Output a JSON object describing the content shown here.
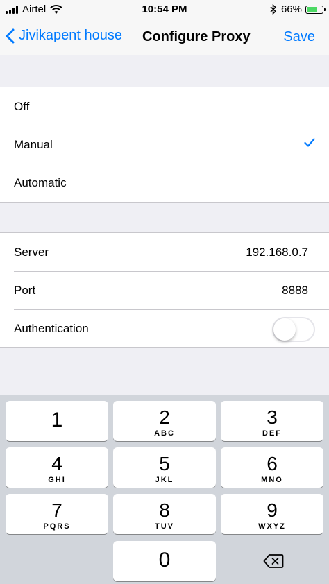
{
  "status_bar": {
    "carrier": "Airtel",
    "time": "10:54 PM",
    "battery_percent": "66%",
    "battery_level": 0.66,
    "icons": [
      "signal-icon",
      "wifi-icon",
      "bluetooth-icon",
      "battery-icon"
    ]
  },
  "nav": {
    "back_label": "Jivikapent house",
    "title": "Configure Proxy",
    "save_label": "Save"
  },
  "proxy_mode": {
    "options": [
      {
        "label": "Off",
        "selected": false
      },
      {
        "label": "Manual",
        "selected": true
      },
      {
        "label": "Automatic",
        "selected": false
      }
    ]
  },
  "proxy_settings": {
    "server_label": "Server",
    "server_value": "192.168.0.7",
    "port_label": "Port",
    "port_value": "8888",
    "auth_label": "Authentication",
    "auth_enabled": false
  },
  "keypad": {
    "keys": [
      {
        "num": "1",
        "letters": ""
      },
      {
        "num": "2",
        "letters": "ABC"
      },
      {
        "num": "3",
        "letters": "DEF"
      },
      {
        "num": "4",
        "letters": "GHI"
      },
      {
        "num": "5",
        "letters": "JKL"
      },
      {
        "num": "6",
        "letters": "MNO"
      },
      {
        "num": "7",
        "letters": "PQRS"
      },
      {
        "num": "8",
        "letters": "TUV"
      },
      {
        "num": "9",
        "letters": "WXYZ"
      },
      {
        "num": "0",
        "letters": ""
      }
    ],
    "accent_color": "#007aff"
  }
}
